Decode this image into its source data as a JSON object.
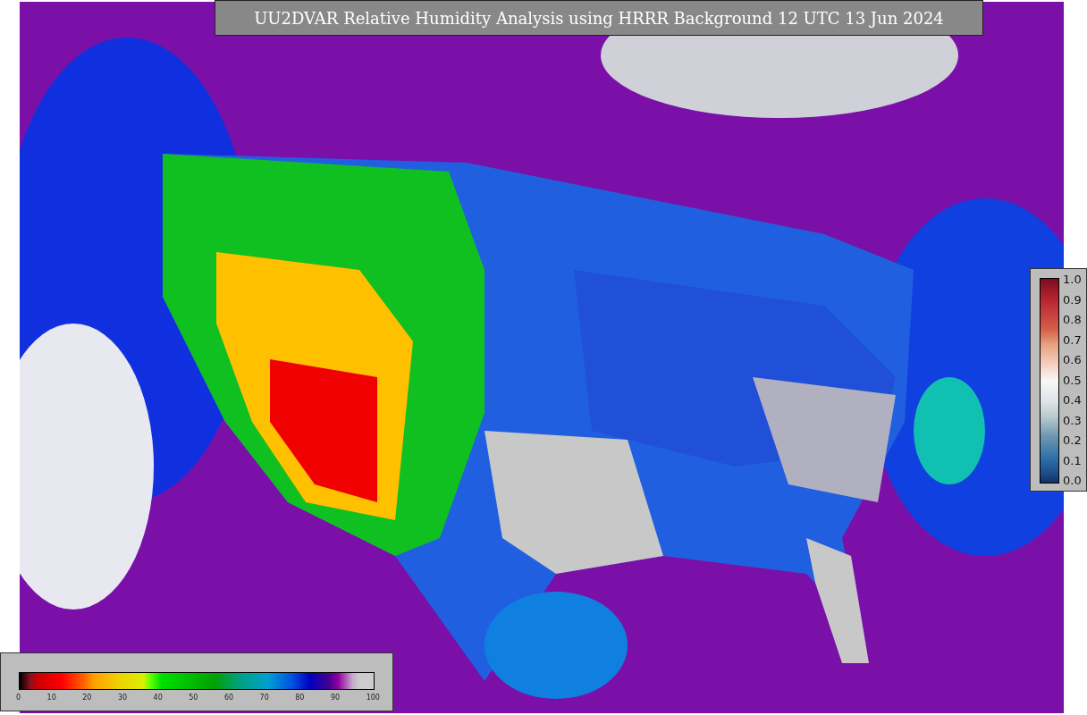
{
  "title": "UU2DVAR Relative Humidity Analysis using HRRR Background 12 UTC 13 Jun 2024",
  "humidity_colorbar": {
    "ticks": [
      "0",
      "10",
      "20",
      "30",
      "40",
      "50",
      "60",
      "70",
      "80",
      "90",
      "100"
    ]
  },
  "weight_colorbar": {
    "ticks": [
      "1.0",
      "0.9",
      "0.8",
      "0.7",
      "0.6",
      "0.5",
      "0.4",
      "0.3",
      "0.2",
      "0.1",
      "0.0"
    ]
  }
}
